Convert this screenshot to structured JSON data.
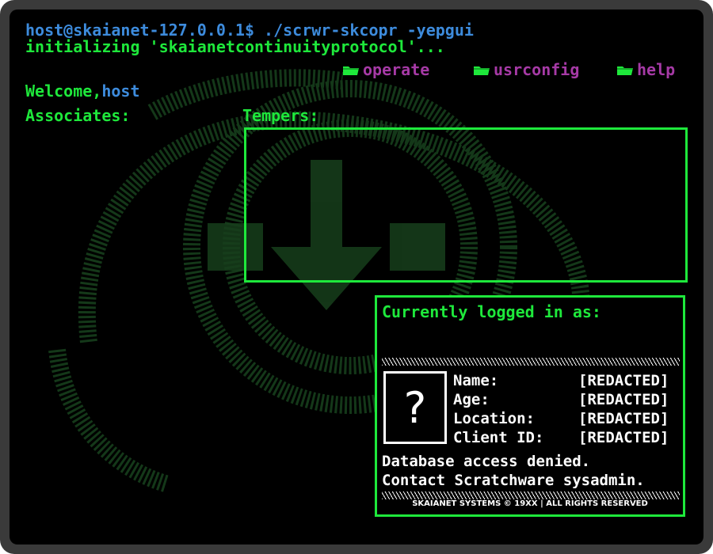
{
  "terminal": {
    "command_line": "host@skaianet-127.0.0.1$ ./scrwr-skcopr -yepgui",
    "init_line": "initializing 'skaianetcontinuityprotocol'..."
  },
  "menu": [
    {
      "label": "operate",
      "icon": "folder-icon"
    },
    {
      "label": "usrconfig",
      "icon": "folder-icon"
    },
    {
      "label": "help",
      "icon": "folder-icon"
    }
  ],
  "welcome": {
    "prefix": "Welcome,",
    "user": "host"
  },
  "sections": {
    "associates": "Associates:",
    "tempers": "Tempers:"
  },
  "login_panel": {
    "title": "Currently logged in as:",
    "avatar_glyph": "?",
    "fields": [
      {
        "key": "Name:",
        "value": "[REDACTED]"
      },
      {
        "key": "Age:",
        "value": "[REDACTED]"
      },
      {
        "key": "Location:",
        "value": "[REDACTED]"
      },
      {
        "key": "Client ID:",
        "value": "[REDACTED]"
      }
    ],
    "message_1": "Database access denied.",
    "message_2": "Contact Scratchware sysadmin.",
    "footer": "SKAIANET SYSTEMS © 19XX | ALL RIGHTS RESERVED"
  },
  "colors": {
    "background": "#000000",
    "frame": "#3a3a3a",
    "green": "#1ee83b",
    "blue": "#3d8bdc",
    "purple": "#a63aa6",
    "emblem": "#1a4a20"
  }
}
